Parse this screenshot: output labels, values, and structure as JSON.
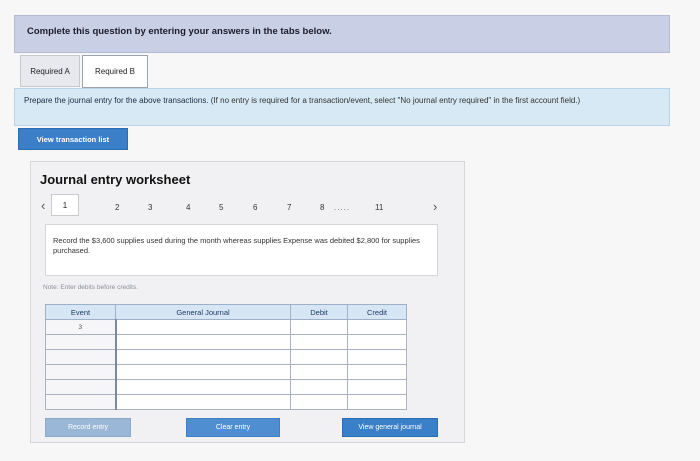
{
  "banner": {
    "text": "Complete this question by entering your answers in the tabs below."
  },
  "tabs": [
    {
      "label": "Required A"
    },
    {
      "label": "Required B"
    }
  ],
  "instructions": {
    "main": "Prepare the journal entry for the above transactions.",
    "tail": " (If no entry is required for a transaction/event, select \"No journal entry required\" in the first account field.)"
  },
  "view_transaction_button": {
    "label": "View transaction list"
  },
  "worksheet": {
    "title": "Journal entry worksheet",
    "pages": [
      "1",
      "2",
      "3",
      "4",
      "5",
      "6",
      "7",
      "8"
    ],
    "ellipsis": ".....",
    "last_page": "11",
    "active_page": "1",
    "description": "Record the $3,600 supplies used during the month whereas supplies Expense was debited $2,800 for supplies purchased.",
    "note": "Note: Enter debits before credits.",
    "table": {
      "headers": [
        "Event",
        "General Journal",
        "Debit",
        "Credit"
      ],
      "rows": [
        {
          "event": "3"
        },
        {
          "event": ""
        },
        {
          "event": ""
        },
        {
          "event": ""
        },
        {
          "event": ""
        },
        {
          "event": ""
        }
      ]
    },
    "buttons": {
      "record": "Record entry",
      "clear": "Clear entry",
      "view_general": "View general journal"
    }
  },
  "icons": {
    "prev": "chevron-left-icon",
    "next": "chevron-right-icon"
  },
  "colors": {
    "banner": "#c9cfe4",
    "instructions": "#d7e9f4",
    "primary_button": "#3a7fc7",
    "header_cell": "#d7e6f5"
  }
}
